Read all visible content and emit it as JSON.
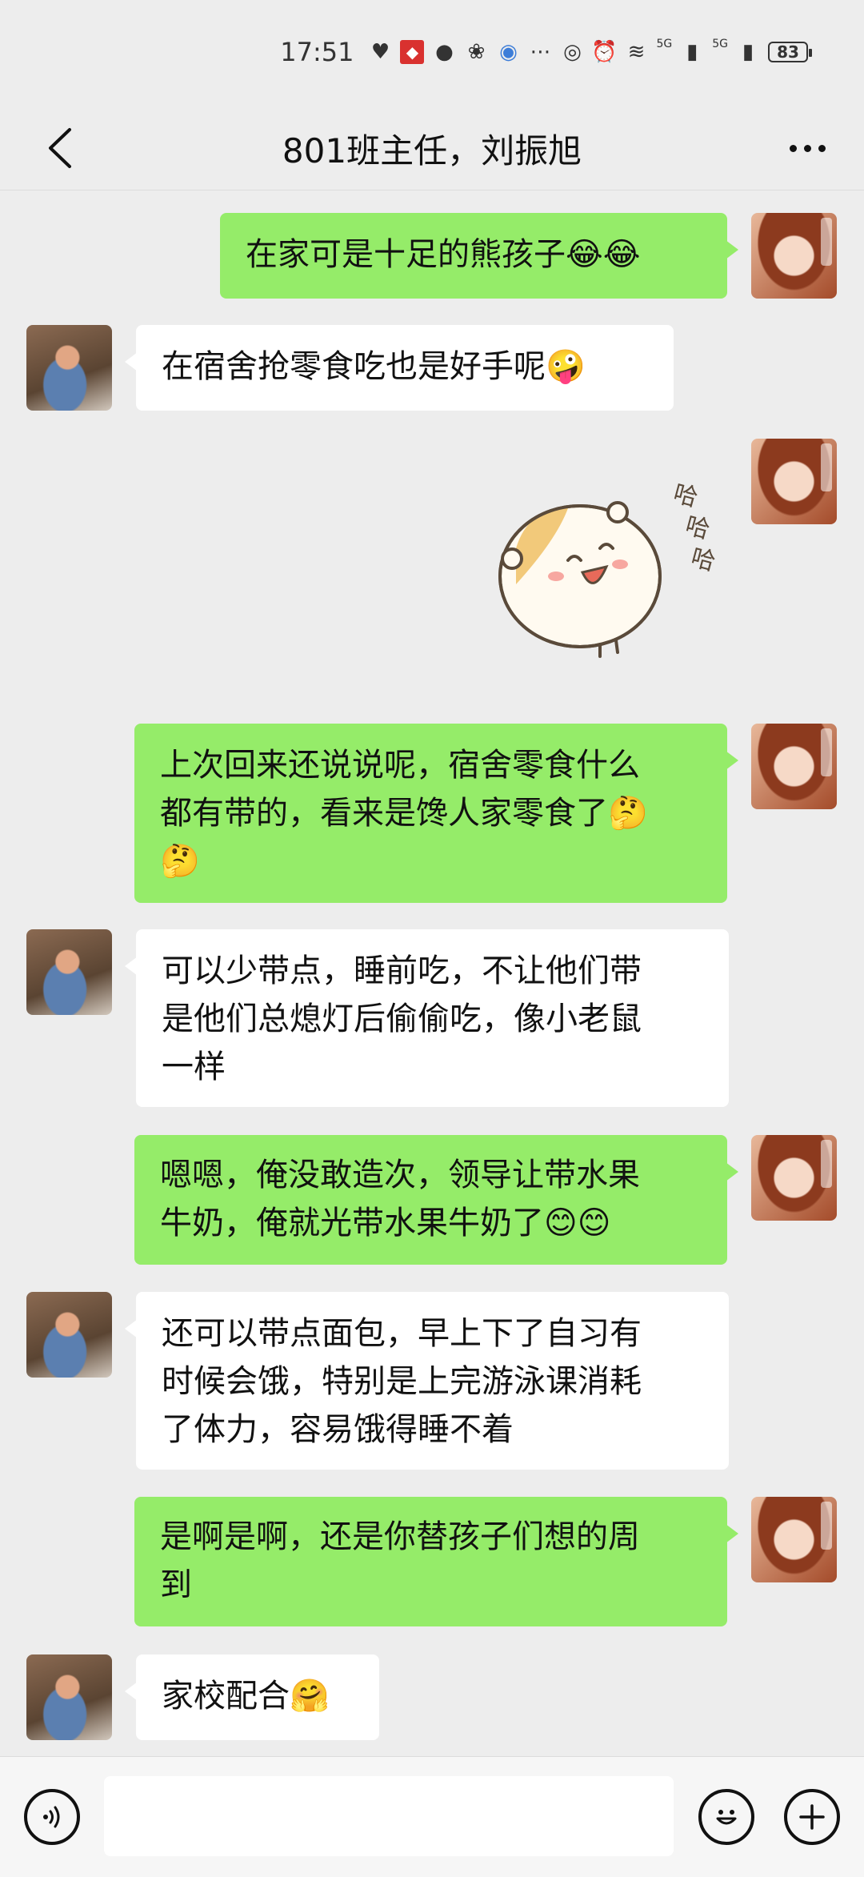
{
  "status_bar": {
    "time": "17:51",
    "network1": "5G",
    "network2": "5G",
    "battery": "83"
  },
  "header": {
    "title": "801班主任，刘振旭"
  },
  "messages": [
    {
      "side": "self",
      "text": "在家可是十足的熊孩子😂😂"
    },
    {
      "side": "other",
      "text": "在宿舍抢零食吃也是好手呢🤪"
    },
    {
      "side": "self",
      "type": "sticker",
      "sticker_text": "哈哈哈"
    },
    {
      "side": "self",
      "lines": [
        "上次回来还说说呢，宿舍零食什么",
        "都有带的，看来是馋人家零食了🤔",
        "🤔"
      ]
    },
    {
      "side": "other",
      "lines": [
        "可以少带点，睡前吃，不让他们带",
        "是他们总熄灯后偷偷吃，像小老鼠",
        "一样"
      ]
    },
    {
      "side": "self",
      "lines": [
        "嗯嗯，俺没敢造次，领导让带水果",
        "牛奶，俺就光带水果牛奶了😊😊"
      ]
    },
    {
      "side": "other",
      "lines": [
        "还可以带点面包，早上下了自习有",
        "时候会饿，特别是上完游泳课消耗",
        "了体力，容易饿得睡不着"
      ]
    },
    {
      "side": "self",
      "lines": [
        "是啊是啊，还是你替孩子们想的周",
        "到"
      ]
    },
    {
      "side": "other",
      "text": "家校配合🤗"
    }
  ]
}
